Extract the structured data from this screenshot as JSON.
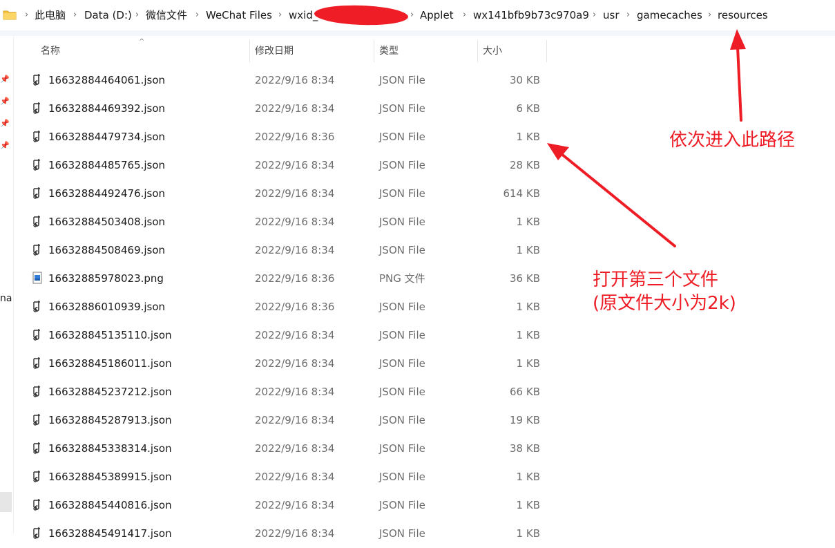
{
  "address_bar": {
    "crumbs": [
      "此电脑",
      "Data (D:)",
      "微信文件",
      "WeChat Files",
      "wxid_",
      "Applet",
      "wx141bfb9b73c970a9",
      "usr",
      "gamecaches",
      "resources"
    ]
  },
  "left_nav": {
    "partial_label": "na"
  },
  "columns": {
    "name": "名称",
    "date": "修改日期",
    "type": "类型",
    "size": "大小"
  },
  "files": [
    {
      "name": "16632884464061.json",
      "date": "2022/9/16 8:34",
      "type": "JSON File",
      "size": "30 KB",
      "icon": "json-file-icon"
    },
    {
      "name": "16632884469392.json",
      "date": "2022/9/16 8:34",
      "type": "JSON File",
      "size": "6 KB",
      "icon": "json-file-icon"
    },
    {
      "name": "16632884479734.json",
      "date": "2022/9/16 8:36",
      "type": "JSON File",
      "size": "1 KB",
      "icon": "json-file-icon"
    },
    {
      "name": "16632884485765.json",
      "date": "2022/9/16 8:34",
      "type": "JSON File",
      "size": "28 KB",
      "icon": "json-file-icon"
    },
    {
      "name": "16632884492476.json",
      "date": "2022/9/16 8:34",
      "type": "JSON File",
      "size": "614 KB",
      "icon": "json-file-icon"
    },
    {
      "name": "16632884503408.json",
      "date": "2022/9/16 8:34",
      "type": "JSON File",
      "size": "1 KB",
      "icon": "json-file-icon"
    },
    {
      "name": "16632884508469.json",
      "date": "2022/9/16 8:34",
      "type": "JSON File",
      "size": "1 KB",
      "icon": "json-file-icon"
    },
    {
      "name": "16632885978023.png",
      "date": "2022/9/16 8:36",
      "type": "PNG 文件",
      "size": "36 KB",
      "icon": "png-file-icon"
    },
    {
      "name": "16632886010939.json",
      "date": "2022/9/16 8:36",
      "type": "JSON File",
      "size": "1 KB",
      "icon": "json-file-icon"
    },
    {
      "name": "166328845135110.json",
      "date": "2022/9/16 8:34",
      "type": "JSON File",
      "size": "1 KB",
      "icon": "json-file-icon"
    },
    {
      "name": "166328845186011.json",
      "date": "2022/9/16 8:34",
      "type": "JSON File",
      "size": "1 KB",
      "icon": "json-file-icon"
    },
    {
      "name": "166328845237212.json",
      "date": "2022/9/16 8:34",
      "type": "JSON File",
      "size": "66 KB",
      "icon": "json-file-icon"
    },
    {
      "name": "166328845287913.json",
      "date": "2022/9/16 8:34",
      "type": "JSON File",
      "size": "19 KB",
      "icon": "json-file-icon"
    },
    {
      "name": "166328845338314.json",
      "date": "2022/9/16 8:34",
      "type": "JSON File",
      "size": "38 KB",
      "icon": "json-file-icon"
    },
    {
      "name": "166328845389915.json",
      "date": "2022/9/16 8:34",
      "type": "JSON File",
      "size": "1 KB",
      "icon": "json-file-icon"
    },
    {
      "name": "166328845440816.json",
      "date": "2022/9/16 8:34",
      "type": "JSON File",
      "size": "1 KB",
      "icon": "json-file-icon"
    },
    {
      "name": "166328845491417.json",
      "date": "2022/9/16 8:34",
      "type": "JSON File",
      "size": "1 KB",
      "icon": "json-file-icon"
    }
  ],
  "annotations": {
    "path_note": "依次进入此路径",
    "open_note_line1": "打开第三个文件",
    "open_note_line2": "(原文件大小为2k)"
  },
  "colors": {
    "annotation_red": "#ee1c25",
    "redaction_red": "#ef1d26",
    "folder_yellow": "#f5c242"
  }
}
